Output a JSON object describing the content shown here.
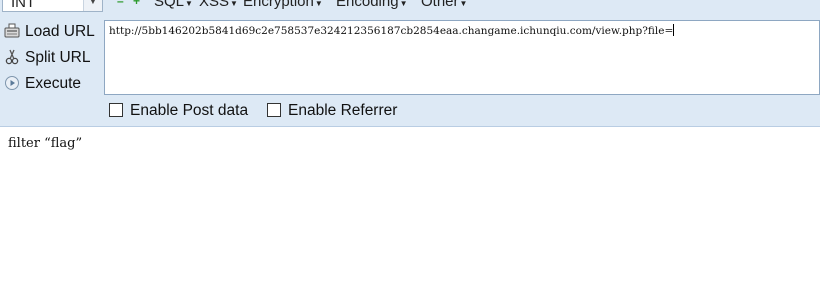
{
  "toolbar": {
    "type_select": {
      "value": "INT"
    },
    "menus": [
      {
        "label": "SQL"
      },
      {
        "label": "XSS"
      },
      {
        "label": "Encryption"
      },
      {
        "label": "Encoding"
      },
      {
        "label": "Other"
      }
    ]
  },
  "actions": {
    "load_url": "Load URL",
    "split_url": "Split URL",
    "execute": "Execute"
  },
  "url_field": {
    "value": "http://5bb146202b5841d69c2e758537e324212356187cb2854eaa.changame.ichunqiu.com/view.php?file="
  },
  "options": {
    "post_data": {
      "label": "Enable Post data",
      "checked": false
    },
    "referrer": {
      "label": "Enable Referrer",
      "checked": false
    }
  },
  "page": {
    "text": "filter “flag”"
  },
  "colors": {
    "panel_bg": "#dde9f5",
    "add_remove_icons": "#2e9b2e"
  }
}
